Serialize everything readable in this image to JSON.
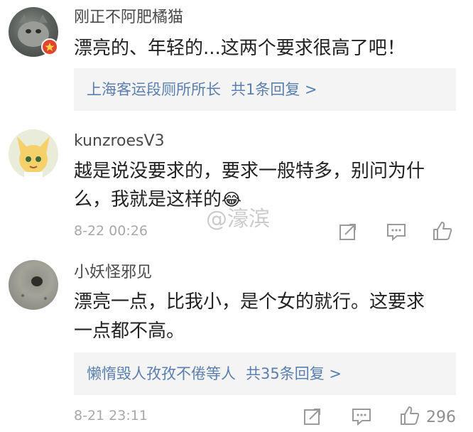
{
  "comments": [
    {
      "username": "刚正不阿肥橘猫",
      "text": "漂亮的、年轻的...这两个要求很高了吧！",
      "reply": {
        "users": "上海客运段厕所所长",
        "count": "共1条回复 >"
      }
    },
    {
      "username": "kunzroesV3",
      "text_line1": "越是说没要求的，要求一般特多，别问为什",
      "text_line2": "么，我就是这样的",
      "emoji": "😂",
      "time": "8-22 00:26"
    },
    {
      "username": "小妖怪邪见",
      "text_line1": "漂亮一点，比我小，是个女的就行。这要求",
      "text_line2": "一点都不高。",
      "reply": {
        "users": "懒惰毁人孜孜不倦等人",
        "count": "共35条回复 >"
      },
      "time": "8-21 23:11",
      "likes": "296"
    }
  ],
  "watermark": "@濠滨",
  "icons": [
    "share-icon",
    "comment-icon",
    "like-icon",
    "verified-badge-icon"
  ],
  "colors": {
    "reply_link": "#5a7fae",
    "meta_gray": "#a8a8a8",
    "badge_red": "#e2452f"
  }
}
